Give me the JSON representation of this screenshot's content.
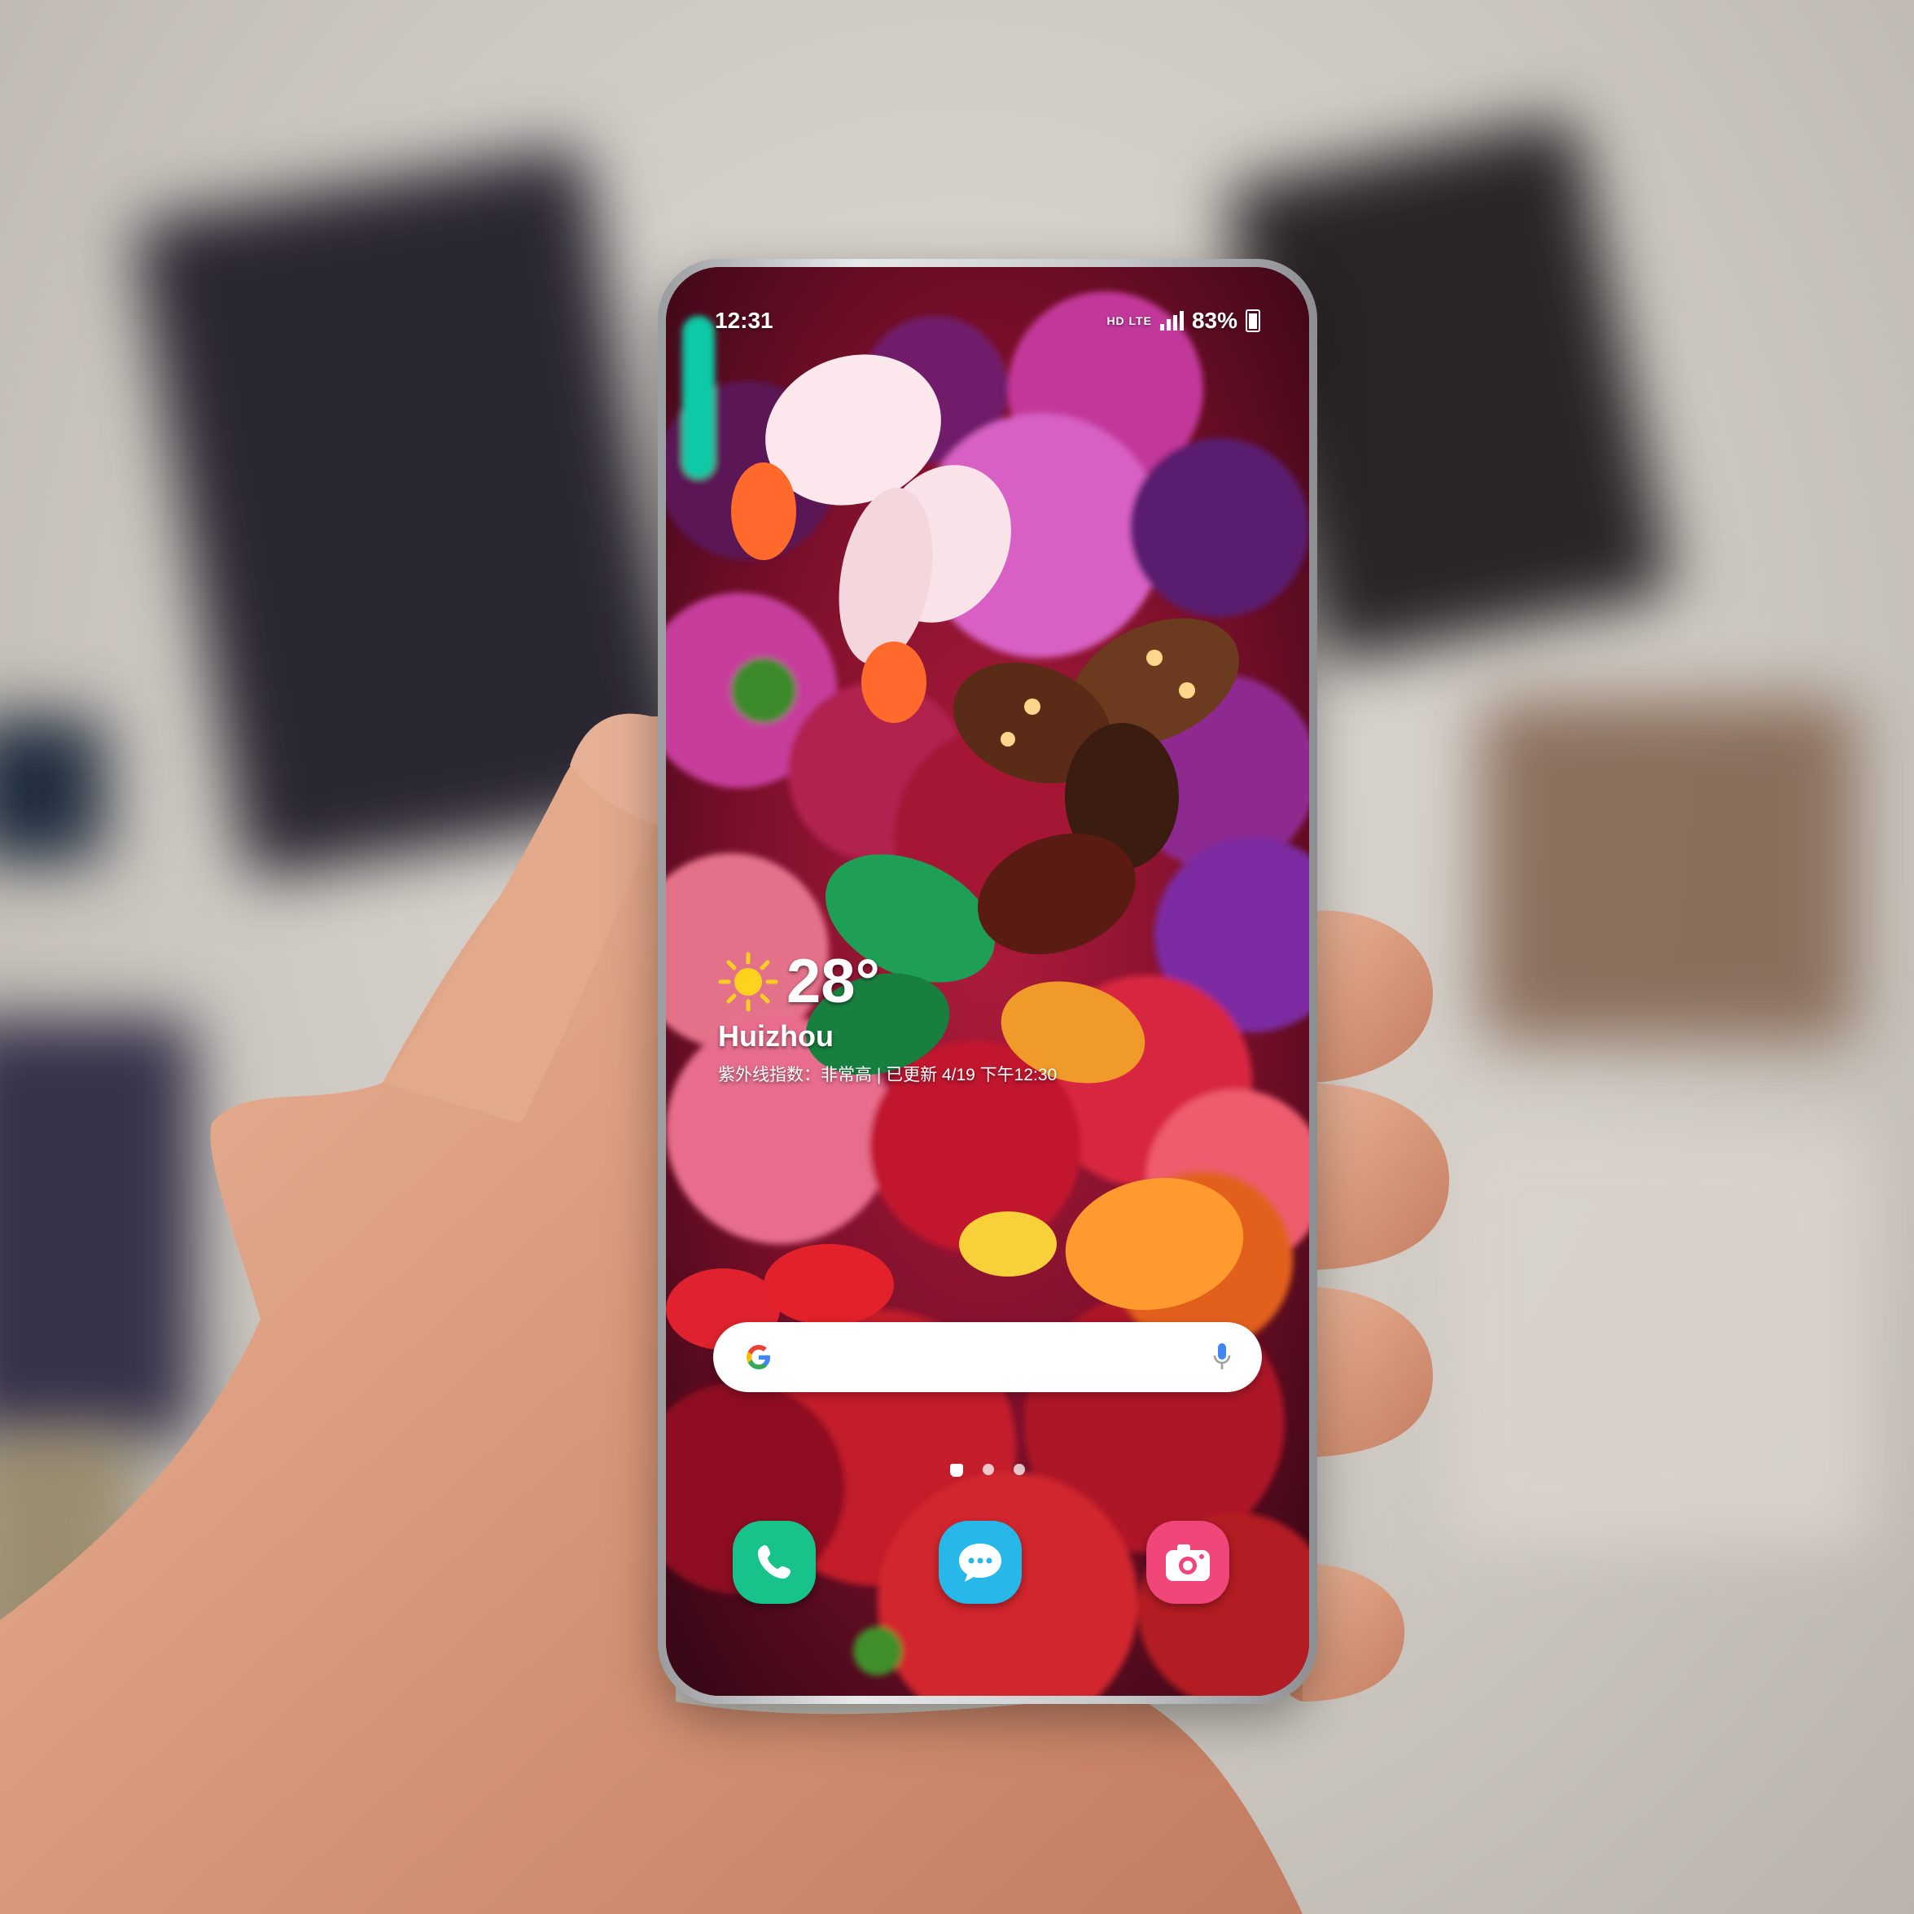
{
  "status_bar": {
    "time": "12:31",
    "network": "HD LTE",
    "battery": "83%"
  },
  "weather": {
    "temperature": "28°",
    "city": "Huizhou",
    "info": "紫外线指数：非常高 | 已更新 4/19 下午12:30"
  },
  "search": {
    "provider_icon": "google-g-icon",
    "voice_icon": "mic-icon"
  },
  "home_pages": {
    "count": 3,
    "current": 1
  },
  "dock": {
    "apps": [
      {
        "icon": "phone-icon",
        "color": "#17c38a"
      },
      {
        "icon": "messages-icon",
        "color": "#27b7e8"
      },
      {
        "icon": "camera-icon",
        "color": "#f0467a"
      }
    ]
  }
}
